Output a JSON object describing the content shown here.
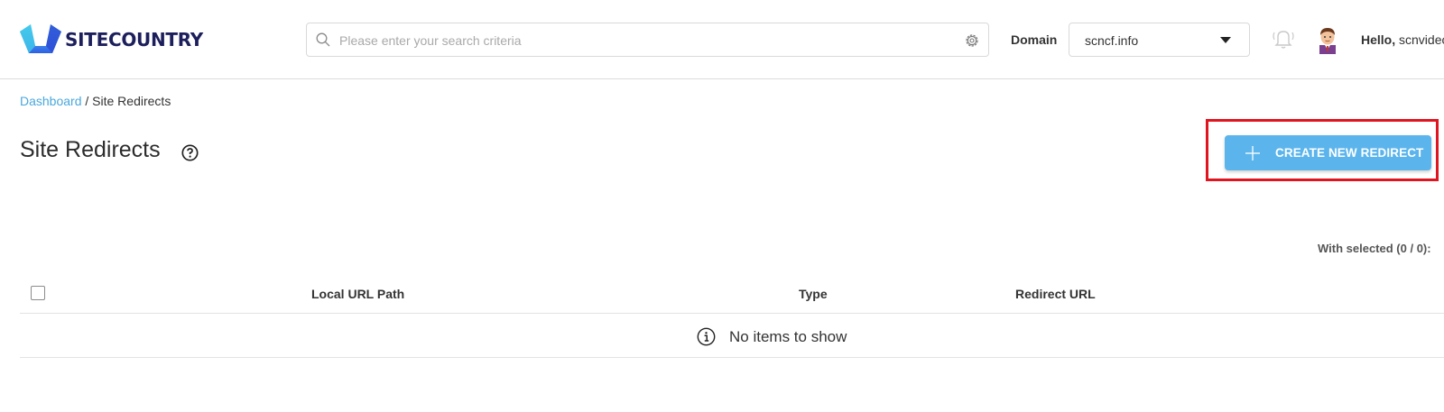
{
  "header": {
    "logo_text": "SITECOUNTRY",
    "search_placeholder": "Please enter your search criteria",
    "domain_label": "Domain",
    "domain_value": "scncf.info",
    "greeting": "Hello,",
    "username": "scnvideo"
  },
  "breadcrumb": {
    "home": "Dashboard",
    "separator": " / ",
    "current": "Site Redirects"
  },
  "page": {
    "title": "Site Redirects",
    "create_button_label": "CREATE NEW REDIRECT",
    "with_selected": "With selected (0 / 0):"
  },
  "table": {
    "columns": [
      "Local URL Path",
      "Type",
      "Redirect URL"
    ],
    "empty_message": "No items to show"
  },
  "colors": {
    "accent": "#5bb5ec",
    "link": "#4aa8dc",
    "highlight": "#e0151f",
    "brand_dark": "#1d1f5c"
  },
  "icons": [
    "logo-icon",
    "search-icon",
    "gear-icon",
    "chevron-down-icon",
    "bell-icon",
    "avatar",
    "help-icon",
    "plus-icon",
    "info-icon"
  ]
}
